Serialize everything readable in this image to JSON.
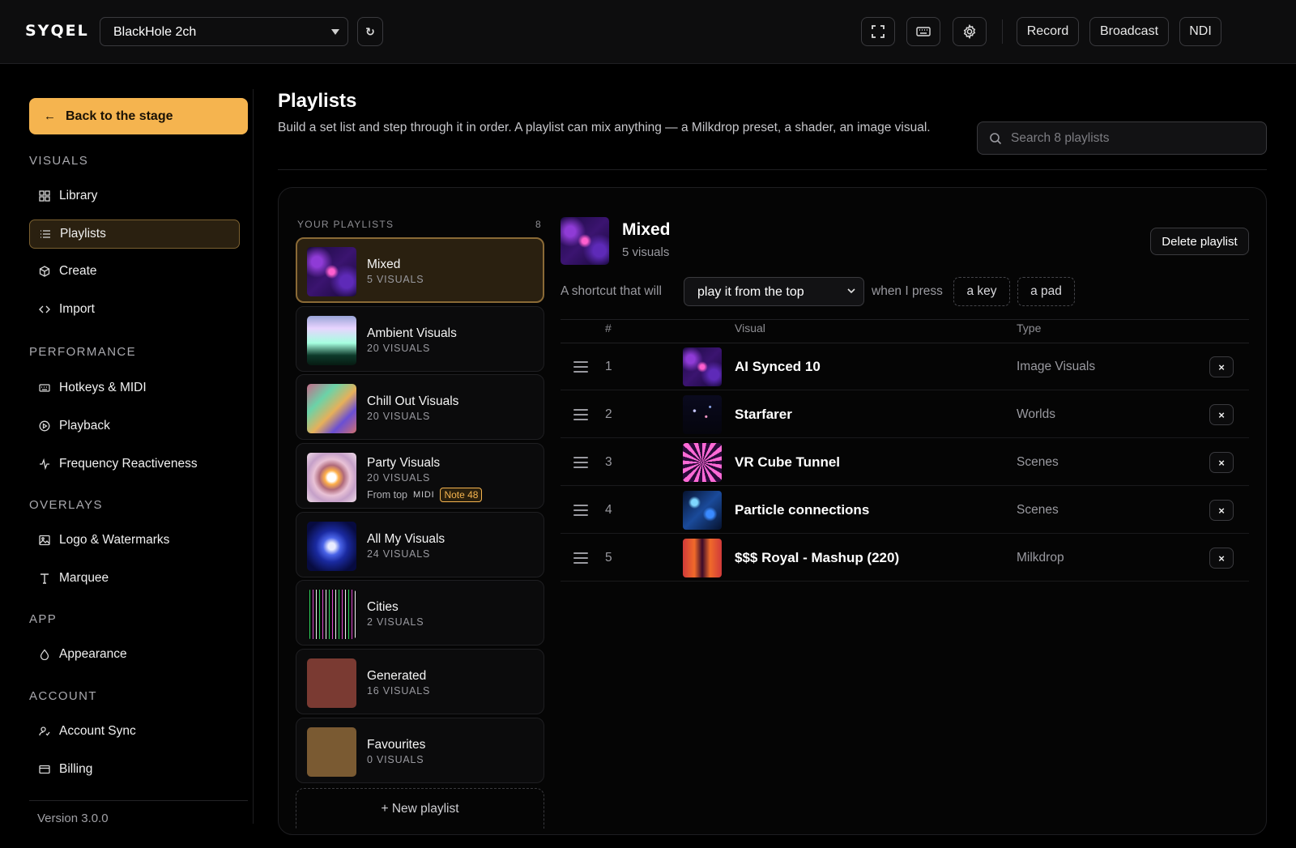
{
  "app": {
    "logo": "SYQEL",
    "device_select": "BlackHole 2ch",
    "refresh_glyph": "↻",
    "buttons": {
      "record": "Record",
      "broadcast": "Broadcast",
      "ndi": "NDI"
    },
    "icons": [
      "fullscreen-icon",
      "keyboard-icon",
      "gear-icon"
    ]
  },
  "sidebar": {
    "back_label": "Back to the stage",
    "sections": [
      {
        "label": "VISUALS",
        "items": [
          "Library",
          "Playlists",
          "Create",
          "Import"
        ]
      },
      {
        "label": "PERFORMANCE",
        "items": [
          "Hotkeys & MIDI",
          "Playback",
          "Frequency Reactiveness"
        ]
      },
      {
        "label": "OVERLAYS",
        "items": [
          "Logo & Watermarks",
          "Marquee"
        ]
      },
      {
        "label": "APP",
        "items": [
          "Appearance"
        ]
      },
      {
        "label": "ACCOUNT",
        "items": [
          "Account Sync",
          "Billing"
        ]
      }
    ],
    "active_item": "Playlists",
    "version": "Version 3.0.0"
  },
  "main": {
    "title": "Playlists",
    "description": "Build a set list and step through it in order. A playlist can mix anything — a Milkdrop preset, a shader, an image visual.",
    "search_placeholder": "Search 8 playlists"
  },
  "playlists": {
    "label": "YOUR PLAYLISTS",
    "count": "8",
    "items": [
      {
        "name": "Mixed",
        "sub": "5 VISUALS",
        "active": true
      },
      {
        "name": "Ambient Visuals",
        "sub": "20 VISUALS"
      },
      {
        "name": "Chill Out Visuals",
        "sub": "20 VISUALS"
      },
      {
        "name": "Party Visuals",
        "sub": "20 VISUALS",
        "meta": {
          "mode": "From top",
          "source": "MIDI",
          "note": "Note 48"
        }
      },
      {
        "name": "All My Visuals",
        "sub": "24 VISUALS"
      },
      {
        "name": "Cities",
        "sub": "2 VISUALS"
      },
      {
        "name": "Generated",
        "sub": "16 VISUALS"
      },
      {
        "name": "Favourites",
        "sub": "0 VISUALS"
      }
    ],
    "new_label": "+ New playlist"
  },
  "detail": {
    "title": "Mixed",
    "sub": "5 visuals",
    "delete_label": "Delete playlist",
    "shortcut": {
      "prefix": "A shortcut that will",
      "action": "play it from the top",
      "middle": "when I press",
      "key": "a key",
      "pad": "a pad"
    },
    "columns": {
      "num": "#",
      "visual": "Visual",
      "type": "Type"
    },
    "rows": [
      {
        "num": "1",
        "name": "AI Synced 10",
        "type": "Image Visuals"
      },
      {
        "num": "2",
        "name": "Starfarer",
        "type": "Worlds"
      },
      {
        "num": "3",
        "name": "VR Cube Tunnel",
        "type": "Scenes"
      },
      {
        "num": "4",
        "name": "Particle connections",
        "type": "Scenes"
      },
      {
        "num": "5",
        "name": "$$$ Royal - Mashup (220)",
        "type": "Milkdrop"
      }
    ],
    "remove_glyph": "×"
  },
  "colors": {
    "accent": "#f5b44f",
    "active_bg": "#2a2010",
    "bg": "#000000"
  }
}
